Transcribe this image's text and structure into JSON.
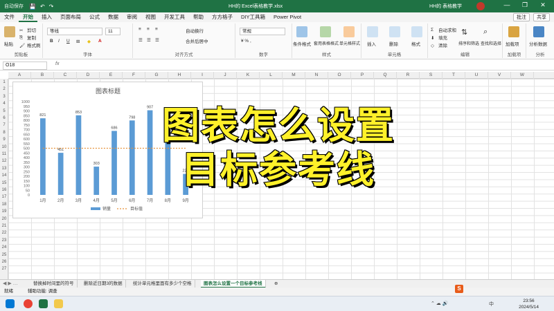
{
  "titlebar": {
    "autosave": "自动保存",
    "doc_title": "HH的 Excel表格教学.xlsx",
    "user": "HH的 表格教学",
    "min": "—",
    "restore": "❐",
    "close": "✕"
  },
  "tabs": [
    "文件",
    "开始",
    "插入",
    "页面布局",
    "公式",
    "数据",
    "审阅",
    "视图",
    "开发工具",
    "帮助",
    "方方格子",
    "DIY工具箱",
    "Power Pivot"
  ],
  "tabs_right": {
    "comment": "批注",
    "share": "共享"
  },
  "ribbon": {
    "paste": "粘贴",
    "cut": "剪切",
    "copy": "复制",
    "format_painter": "格式刷",
    "clipboard_label": "剪贴板",
    "font_name": "等线",
    "font_size": "11",
    "font_label": "字体",
    "wrap": "自动换行",
    "merge": "合并后居中",
    "align_label": "对齐方式",
    "number_format": "常规",
    "number_label": "数字",
    "cond_format": "条件格式",
    "table_format": "套用表格格式",
    "cell_style": "单元格样式",
    "style_label": "样式",
    "insert": "插入",
    "delete": "删除",
    "format": "格式",
    "cells_label": "单元格",
    "autosum": "自动求和",
    "fill": "填充",
    "clear": "清除",
    "sort_filter": "排序和筛选",
    "find_select": "查找和选择",
    "edit_label": "编辑",
    "addins": "加载项",
    "addins_label": "加载项",
    "analyze": "分析数据",
    "analysis_label": "分析"
  },
  "formula_bar": {
    "name_box": "O18",
    "fx": "fx",
    "value": ""
  },
  "columns": [
    "A",
    "B",
    "C",
    "D",
    "E",
    "F",
    "G",
    "H",
    "I",
    "J",
    "K",
    "L",
    "M",
    "N",
    "O",
    "P",
    "Q",
    "R",
    "S",
    "T",
    "U",
    "V",
    "W"
  ],
  "rows": [
    "1",
    "2",
    "3",
    "4",
    "5",
    "6",
    "7",
    "8",
    "9",
    "10",
    "11",
    "12",
    "13",
    "14",
    "15",
    "16",
    "17",
    "18",
    "19",
    "20",
    "21",
    "22",
    "23",
    "24",
    "25",
    "26",
    "27"
  ],
  "chart_data": {
    "type": "bar",
    "title": "图表标题",
    "categories": [
      "1月",
      "2月",
      "3月",
      "4月",
      "5月",
      "6月",
      "7月",
      "8月",
      "9月"
    ],
    "series": [
      {
        "name": "销量",
        "type": "bar",
        "values": [
          821,
          451,
          853,
          303,
          686,
          798,
          907,
          586,
          225
        ]
      },
      {
        "name": "目标值",
        "type": "line",
        "values": [
          500,
          500,
          500,
          500,
          500,
          500,
          500,
          500,
          500
        ]
      }
    ],
    "yticks": [
      0,
      50,
      100,
      150,
      200,
      250,
      300,
      350,
      400,
      450,
      500,
      550,
      600,
      650,
      700,
      750,
      800,
      850,
      900,
      950,
      1000
    ],
    "ylim": [
      0,
      1000
    ],
    "legend": "bottom",
    "bar_color": "#5b9bd5",
    "line_color": "#e69138"
  },
  "overlay": {
    "line1": "图表怎么设置",
    "line2": "目标参考线"
  },
  "sheets": [
    "替换掉时间里的符号",
    "删除近日期3的数据",
    "统计单元格里面有多少个空格",
    "图表怎么设置一个目标参考线"
  ],
  "active_sheet": 3,
  "status": {
    "ready": "就绪",
    "accessibility": "辅助功能: 调查"
  },
  "taskbar": {
    "time": "23:56",
    "date": "2024/5/14",
    "lang": "中",
    "ime": "S"
  }
}
